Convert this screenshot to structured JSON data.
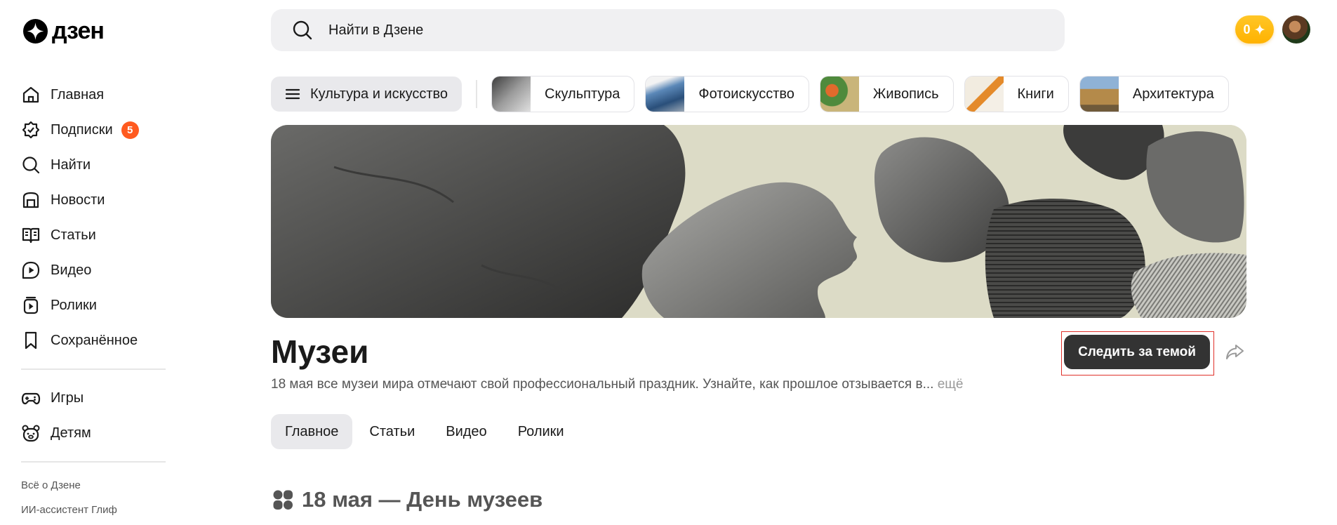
{
  "logo": {
    "text": "дзен"
  },
  "search": {
    "placeholder": "Найти в Дзене"
  },
  "header": {
    "coins": "0"
  },
  "sidebar": {
    "items": [
      {
        "label": "Главная",
        "icon": "home-icon"
      },
      {
        "label": "Подписки",
        "icon": "subscriptions-icon",
        "badge": "5"
      },
      {
        "label": "Найти",
        "icon": "search-icon"
      },
      {
        "label": "Новости",
        "icon": "news-icon"
      },
      {
        "label": "Статьи",
        "icon": "articles-icon"
      },
      {
        "label": "Видео",
        "icon": "video-icon"
      },
      {
        "label": "Ролики",
        "icon": "shorts-icon"
      },
      {
        "label": "Сохранённое",
        "icon": "bookmark-icon"
      }
    ],
    "items2": [
      {
        "label": "Игры",
        "icon": "gamepad-icon"
      },
      {
        "label": "Детям",
        "icon": "kids-icon"
      }
    ],
    "footer_links": [
      "Всё о Дзене",
      "ИИ-ассистент Глиф"
    ]
  },
  "categories": {
    "main": "Культура и искусство",
    "chips": [
      "Скульптура",
      "Фотоискусство",
      "Живопись",
      "Книги",
      "Архитектура"
    ]
  },
  "topic": {
    "title": "Музеи",
    "description": "18 мая все музеи мира отмечают свой профессиональный праздник. Узнайте, как прошлое отзывается в...",
    "more": " ещё",
    "follow": "Следить за темой"
  },
  "tabs": [
    "Главное",
    "Статьи",
    "Видео",
    "Ролики"
  ],
  "section": {
    "title": "18 мая — День музеев"
  },
  "colors": {
    "accent_badge": "#ff5a1f",
    "follow_button": "#333333",
    "coins": "#ffb200",
    "highlight_frame": "#e0302a"
  }
}
